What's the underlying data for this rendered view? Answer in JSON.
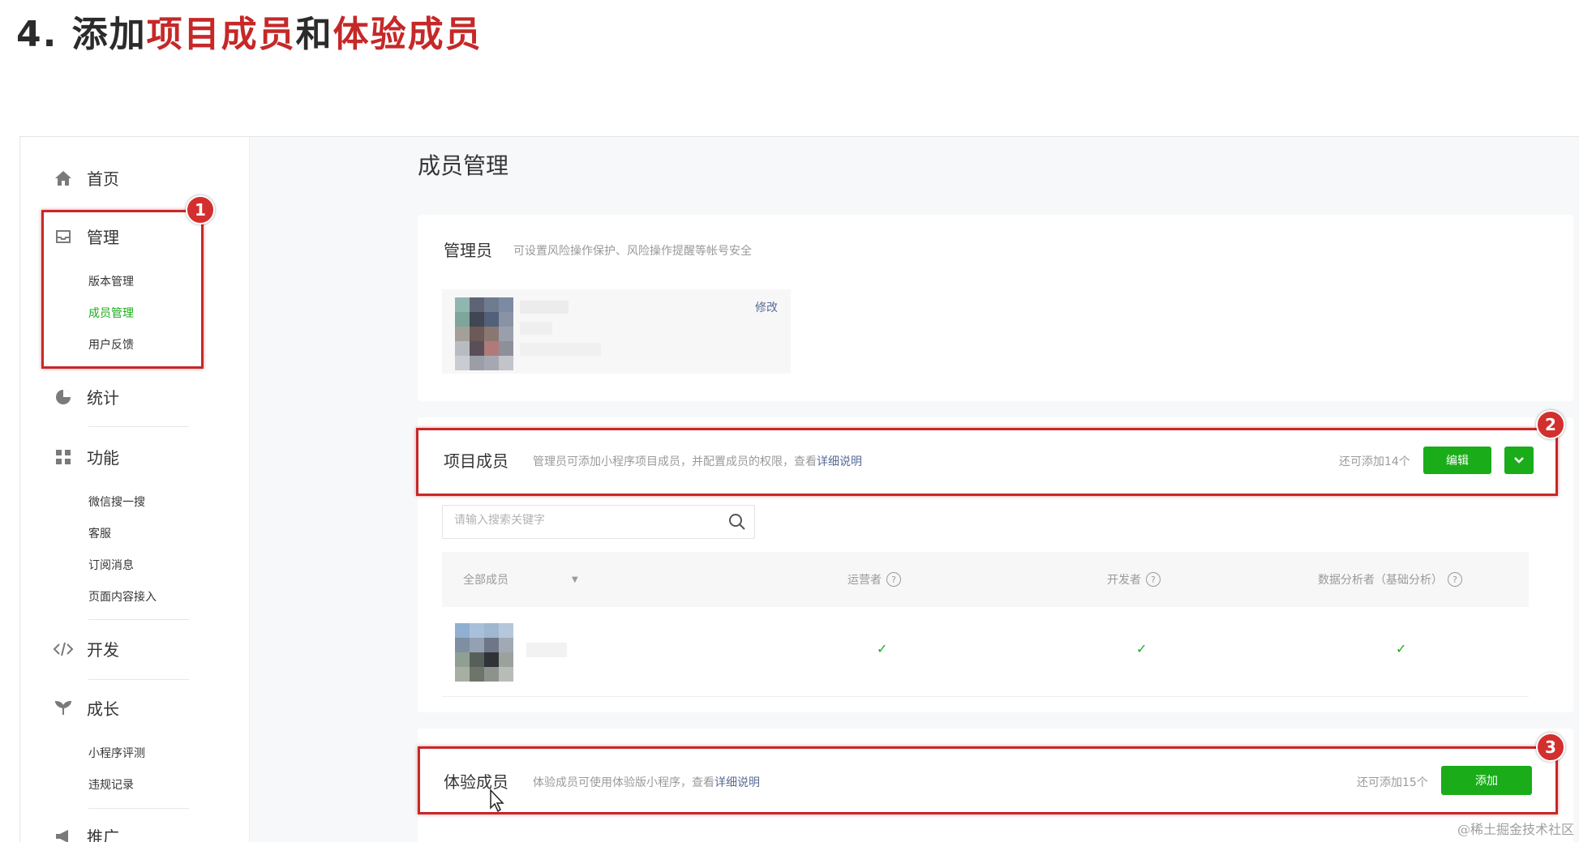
{
  "heading": {
    "number": "4.",
    "part1": "添加",
    "part2": "项目成员",
    "part3": "和",
    "part4": "体验成员"
  },
  "sidebar": {
    "home": "首页",
    "manage": "管理",
    "manage_items": [
      "版本管理",
      "成员管理",
      "用户反馈"
    ],
    "stats": "统计",
    "features": "功能",
    "feature_items": [
      "微信搜一搜",
      "客服",
      "订阅消息",
      "页面内容接入"
    ],
    "develop": "开发",
    "growth": "成长",
    "growth_items": [
      "小程序评测",
      "违规记录"
    ],
    "promote": "推广"
  },
  "main": {
    "title": "成员管理",
    "admin": {
      "title": "管理员",
      "desc": "可设置风险操作保护、风险操作提醒等帐号安全",
      "edit_link": "修改"
    },
    "project": {
      "title": "项目成员",
      "desc": "管理员可添加小程序项目成员，并配置成员的权限，查看",
      "desc_link": "详细说明",
      "remaining": "还可添加14个",
      "edit_button": "编辑",
      "search_placeholder": "请输入搜索关键字",
      "columns": [
        "全部成员",
        "运营者",
        "开发者",
        "数据分析者（基础分析）"
      ],
      "check_mark": "✓"
    },
    "experience": {
      "title": "体验成员",
      "desc": "体验成员可使用体验版小程序，查看",
      "desc_link": "详细说明",
      "remaining": "还可添加15个",
      "add_button": "添加"
    }
  },
  "annotations": [
    "1",
    "2",
    "3"
  ],
  "watermark": "@稀土掘金技术社区",
  "colors": {
    "accent_green": "#1aad19",
    "highlight_red": "#c62828",
    "link_blue": "#576b95"
  }
}
